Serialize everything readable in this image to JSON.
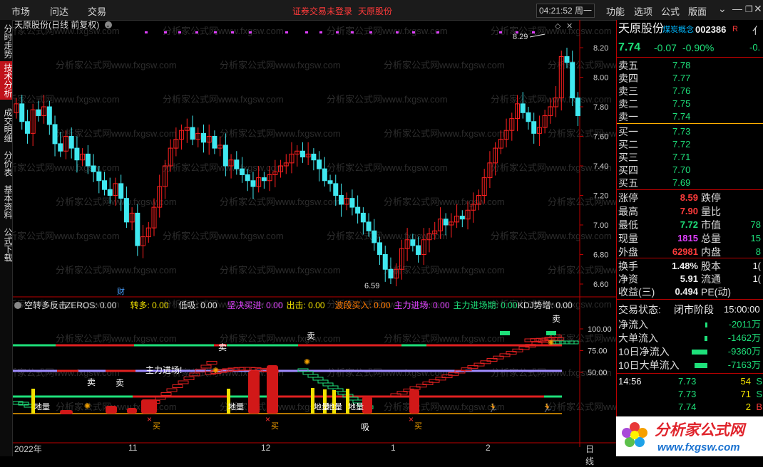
{
  "topbar": {
    "menu": [
      "市场",
      "问达",
      "交易"
    ],
    "warning": "证券交易未登录",
    "stock_name": "天原股份",
    "time": "04:21:52 周一",
    "right_menu": [
      "功能",
      "选项",
      "公式",
      "版面"
    ]
  },
  "sidebar": {
    "tabs": [
      "分时走势",
      "技术分析",
      "成交明细",
      "分价表",
      "基本资料",
      "公式下载"
    ],
    "active": 1
  },
  "chart": {
    "title": "天原股份(日线 前复权)",
    "price_labels": [
      "8.20",
      "8.00",
      "7.80",
      "7.60",
      "7.40",
      "7.20",
      "7.00",
      "6.80",
      "6.60"
    ],
    "high_label": "8.29",
    "low_label": "6.59",
    "finance_tag": "财",
    "watermark": "分析家公式网www.fxgsw.com"
  },
  "indicator": {
    "name": "空转多反击",
    "params": [
      {
        "label": "ZEROS:",
        "value": "0.00",
        "color": "#dddddd"
      },
      {
        "label": "转多:",
        "value": "0.00",
        "color": "#f2e200"
      },
      {
        "label": "低吸:",
        "value": "0.00",
        "color": "#dddddd"
      },
      {
        "label": "坚决买进:",
        "value": "0.00",
        "color": "#e040ff"
      },
      {
        "label": "出击:",
        "value": "0.00",
        "color": "#f2e200"
      },
      {
        "label": "波段买入:",
        "value": "0.00",
        "color": "#ff7a00"
      },
      {
        "label": "主力进场:",
        "value": "0.00",
        "color": "#e040ff"
      },
      {
        "label": "主力进场期:",
        "value": "0.00",
        "color": "#1ee07a"
      },
      {
        "label": "KDJ势增:",
        "value": "0.00",
        "color": "#dddddd"
      }
    ],
    "axis_labels": [
      "100.00",
      "75.00",
      "50.00"
    ],
    "annotations": {
      "sell": "卖",
      "buy": "买",
      "absorb": "吸",
      "entry": "主力进场!",
      "bottom_volume": "地量"
    }
  },
  "x_axis": [
    "2022年",
    "11",
    "12",
    "1",
    "2"
  ],
  "period": "日线",
  "quote": {
    "name": "天原股份",
    "concept": "煤炭概念",
    "code": "002386",
    "r_tag": "R",
    "price": "7.74",
    "change": "-0.07",
    "change_pct": "-0.90%",
    "side_tab": "亻",
    "side_val": "-0.",
    "asks": [
      {
        "label": "卖五",
        "price": "7.78"
      },
      {
        "label": "卖四",
        "price": "7.77"
      },
      {
        "label": "卖三",
        "price": "7.76"
      },
      {
        "label": "卖二",
        "price": "7.75"
      },
      {
        "label": "卖一",
        "price": "7.74"
      }
    ],
    "bids": [
      {
        "label": "买一",
        "price": "7.73"
      },
      {
        "label": "买二",
        "price": "7.72"
      },
      {
        "label": "买三",
        "price": "7.71"
      },
      {
        "label": "买四",
        "price": "7.70"
      },
      {
        "label": "买五",
        "price": "7.69"
      }
    ],
    "stats": [
      {
        "l1": "涨停",
        "v1": "8.59",
        "c1": "up",
        "l2": "跌停",
        "v2": ""
      },
      {
        "l1": "最高",
        "v1": "7.90",
        "c1": "up",
        "l2": "量比",
        "v2": ""
      },
      {
        "l1": "最低",
        "v1": "7.72",
        "c1": "down",
        "l2": "市值",
        "v2": "78"
      },
      {
        "l1": "现量",
        "v1": "1815",
        "c1": "purple",
        "l2": "总量",
        "v2": "15"
      },
      {
        "l1": "外盘",
        "v1": "62981",
        "c1": "up",
        "l2": "内盘",
        "v2": "8"
      }
    ],
    "stats2": [
      {
        "l1": "换手",
        "v1": "1.48%",
        "l2": "股本",
        "v2": "1("
      },
      {
        "l1": "净资",
        "v1": "5.91",
        "l2": "流通",
        "v2": "1("
      },
      {
        "l1": "收益(三)",
        "v1": "0.494",
        "l2": "PE(动)",
        "v2": ""
      }
    ],
    "trade_state_label": "交易状态:",
    "trade_state": "闭市阶段",
    "trade_time": "15:00:00",
    "flows": [
      {
        "label": "净流入",
        "value": "-2011万"
      },
      {
        "label": "大单流入",
        "value": "-1462万"
      },
      {
        "label": "10日净流入",
        "value": "-9360万"
      },
      {
        "label": "10日大单流入",
        "value": "-7163万"
      }
    ],
    "ticks": [
      {
        "time": "14:56",
        "price": "7.73",
        "vol": "54",
        "side": "S"
      },
      {
        "time": "",
        "price": "7.73",
        "vol": "71",
        "side": "S"
      },
      {
        "time": "",
        "price": "7.74",
        "vol": "2",
        "side": "B"
      }
    ]
  },
  "logo": {
    "title": "分析家公式网",
    "url": "www.fxgsw.com"
  }
}
